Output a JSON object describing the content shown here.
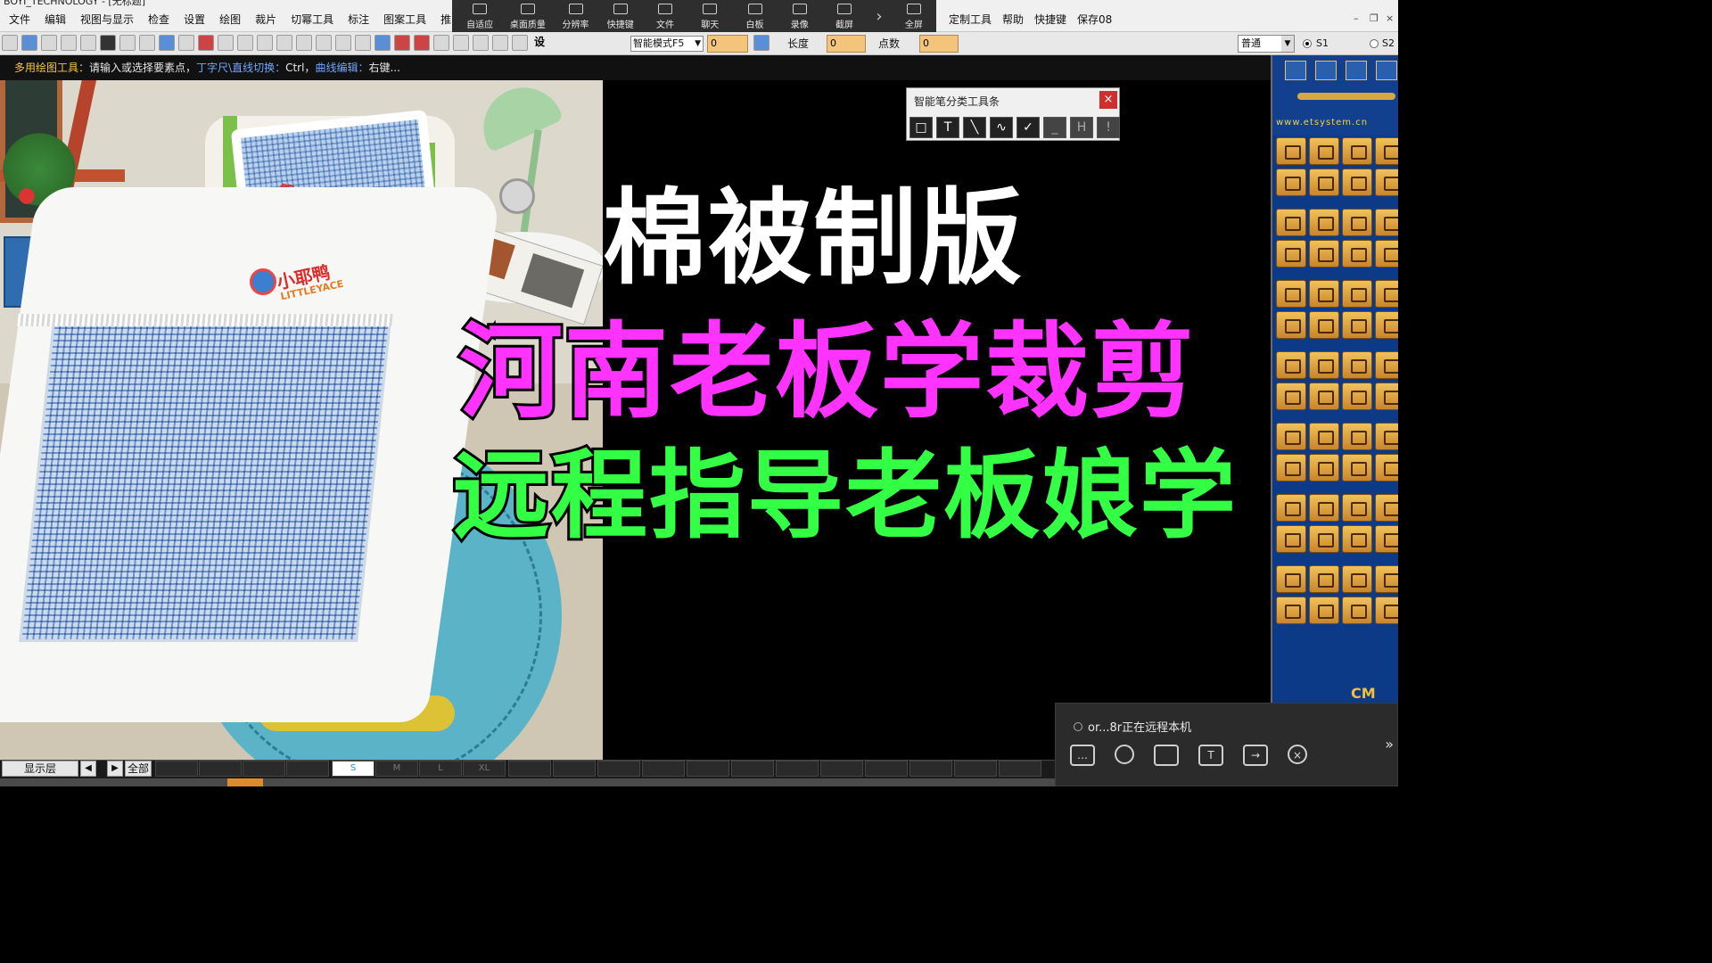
{
  "window": {
    "title_fragment": "BOYI_TECHNOLOGY - [无标题]"
  },
  "menu": {
    "left_items": [
      "文件",
      "编辑",
      "视图与显示",
      "检查",
      "设置",
      "绘图",
      "裁片",
      "切幂工具",
      "标注",
      "图案工具",
      "推"
    ],
    "right_items": [
      "定制工具",
      "帮助",
      "快捷键",
      "保存08"
    ]
  },
  "remote_toolbar": {
    "items": [
      "自适应",
      "桌面质量",
      "分辨率",
      "快捷键",
      "文件",
      "聊天",
      "白板",
      "录像",
      "截屏"
    ],
    "fullscreen_label": "全屏"
  },
  "toolbar2": {
    "mode_select": "智能模式F5",
    "field1_value": "0",
    "length_label": "长度",
    "length_value": "0",
    "points_label": "点数",
    "points_value": "0",
    "setting_glyph": "设",
    "pattern_select": "普通",
    "s1_label": "S1",
    "s2_label": "S2"
  },
  "hint": {
    "part1": "多用绘图工具：",
    "part2": "请输入或选择要素点，",
    "part3": "丁字尺\\直线切换：",
    "part4": "Ctrl，",
    "part5": "曲线编辑：",
    "part6": "右键..."
  },
  "photo": {
    "logo_cn": "小耶鸭",
    "logo_en": "LITTLEYACE"
  },
  "headline": {
    "line1": "棉被制版",
    "line2": "河南老板学裁剪",
    "line3": "远程指导老板娘学"
  },
  "colors": {
    "line1": "#ffffff",
    "line2": "#ff33ff",
    "line3": "#33ff44",
    "palette_bg": "#0d3a86",
    "hint_blue": "#6fa8ff",
    "hint_yellow": "#f5c542"
  },
  "pen_toolbar": {
    "title": "智能笔分类工具条",
    "close": "×",
    "tools": [
      "□",
      "T",
      "╲",
      "∿",
      "✓",
      "_",
      "H",
      "!"
    ]
  },
  "palette": {
    "url": "www.etsystem.cn",
    "cm_label": "CM"
  },
  "bottom": {
    "layer_button": "显示层",
    "prev": "◀",
    "next": "▶",
    "all_button": "全部",
    "sizes": [
      "",
      "",
      "",
      "",
      "",
      "",
      "",
      "S",
      "M",
      "L",
      "XL",
      "",
      "",
      "",
      "",
      "",
      "",
      "",
      "",
      "",
      "",
      "",
      ""
    ]
  },
  "remote_session": {
    "user_text": "or...8r正在远程本机",
    "icons": [
      "chat-icon",
      "mic-icon",
      "screen-icon",
      "text-icon",
      "folder-icon",
      "close-icon"
    ],
    "arrow": "»"
  }
}
